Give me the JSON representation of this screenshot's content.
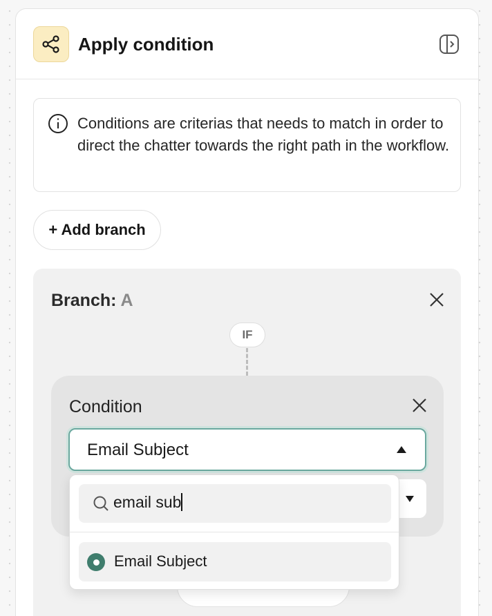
{
  "header": {
    "title": "Apply condition",
    "icon": "branching-nodes-icon",
    "icon_bg": "#fbedc2",
    "collapse_icon": "collapse-panel-icon"
  },
  "info": {
    "icon": "info-icon",
    "text": "Conditions are criterias that needs to match in order to direct the chatter towards the right path in the workflow."
  },
  "actions": {
    "add_branch_label": "+ Add branch"
  },
  "branch": {
    "label": "Branch:",
    "letter": "A",
    "if_label": "IF",
    "close_icon": "close-icon",
    "condition": {
      "title": "Condition",
      "close_icon": "close-icon",
      "field_select": {
        "value": "Email Subject",
        "state": "open",
        "accent": "#6aa89e"
      }
    }
  },
  "dropdown": {
    "search": {
      "icon": "search-icon",
      "value": "email sub"
    },
    "options": [
      {
        "label": "Email Subject",
        "selected": true,
        "color": "#3f7d6d"
      }
    ]
  }
}
